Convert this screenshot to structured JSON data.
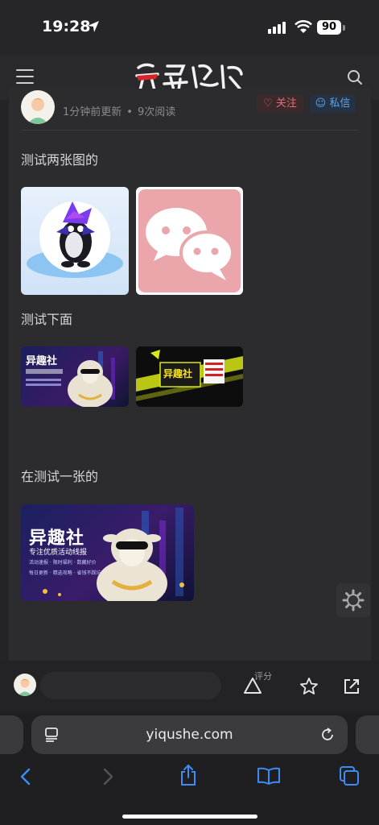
{
  "status_bar": {
    "time": "19:28",
    "battery": "90"
  },
  "site": {
    "logo_text": "异趣社"
  },
  "author": {
    "update_time": "1分钟前更新",
    "read_count": "9次阅读",
    "follow_label": "关注",
    "message_label": "私信"
  },
  "article": {
    "heading1": "测试两张图的",
    "heading2": "测试下面",
    "heading3": "在测试一张的",
    "banner": {
      "brand": "异趣社",
      "tagline": "专注优质活动线报",
      "tags1": "活动速报 · 限时福利 · 数藏好价",
      "tags2": "每日更新 · 精选攻略 · 省钱不踩坑"
    }
  },
  "bottom_bar": {
    "rate_label": "评分"
  },
  "browser": {
    "url": "yiqushe.com"
  }
}
